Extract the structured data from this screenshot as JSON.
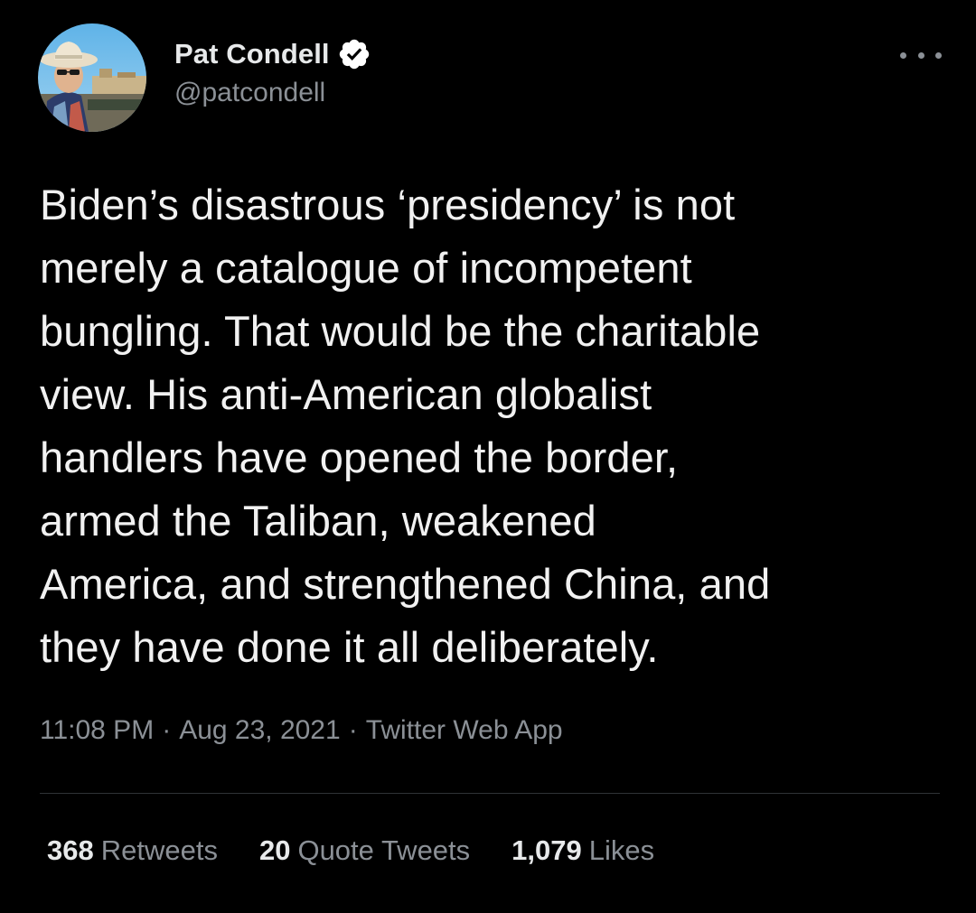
{
  "author": {
    "display_name": "Pat Condell",
    "handle": "@patcondell",
    "verified": true,
    "verified_icon": "verified-badge-icon",
    "more_icon": "more-options-icon"
  },
  "tweet": {
    "text": "Biden’s disastrous ‘presidency’ is not\nmerely a catalogue of incompetent\nbungling. That would be the charitable\nview. His anti-American globalist\nhandlers have opened the border,\narmed the Taliban, weakened\nAmerica, and strengthened China, and\nthey have done it all deliberately.",
    "time": "11:08 PM",
    "separator": "·",
    "date": "Aug 23, 2021",
    "source": "Twitter Web App"
  },
  "stats": {
    "retweets": {
      "count": "368",
      "label": "Retweets"
    },
    "quote_tweets": {
      "count": "20",
      "label": "Quote Tweets"
    },
    "likes": {
      "count": "1,079",
      "label": "Likes"
    }
  },
  "colors": {
    "background": "#000000",
    "text_primary": "#e7e9ea",
    "text_secondary": "#8b9096",
    "divider": "#2f3336"
  }
}
